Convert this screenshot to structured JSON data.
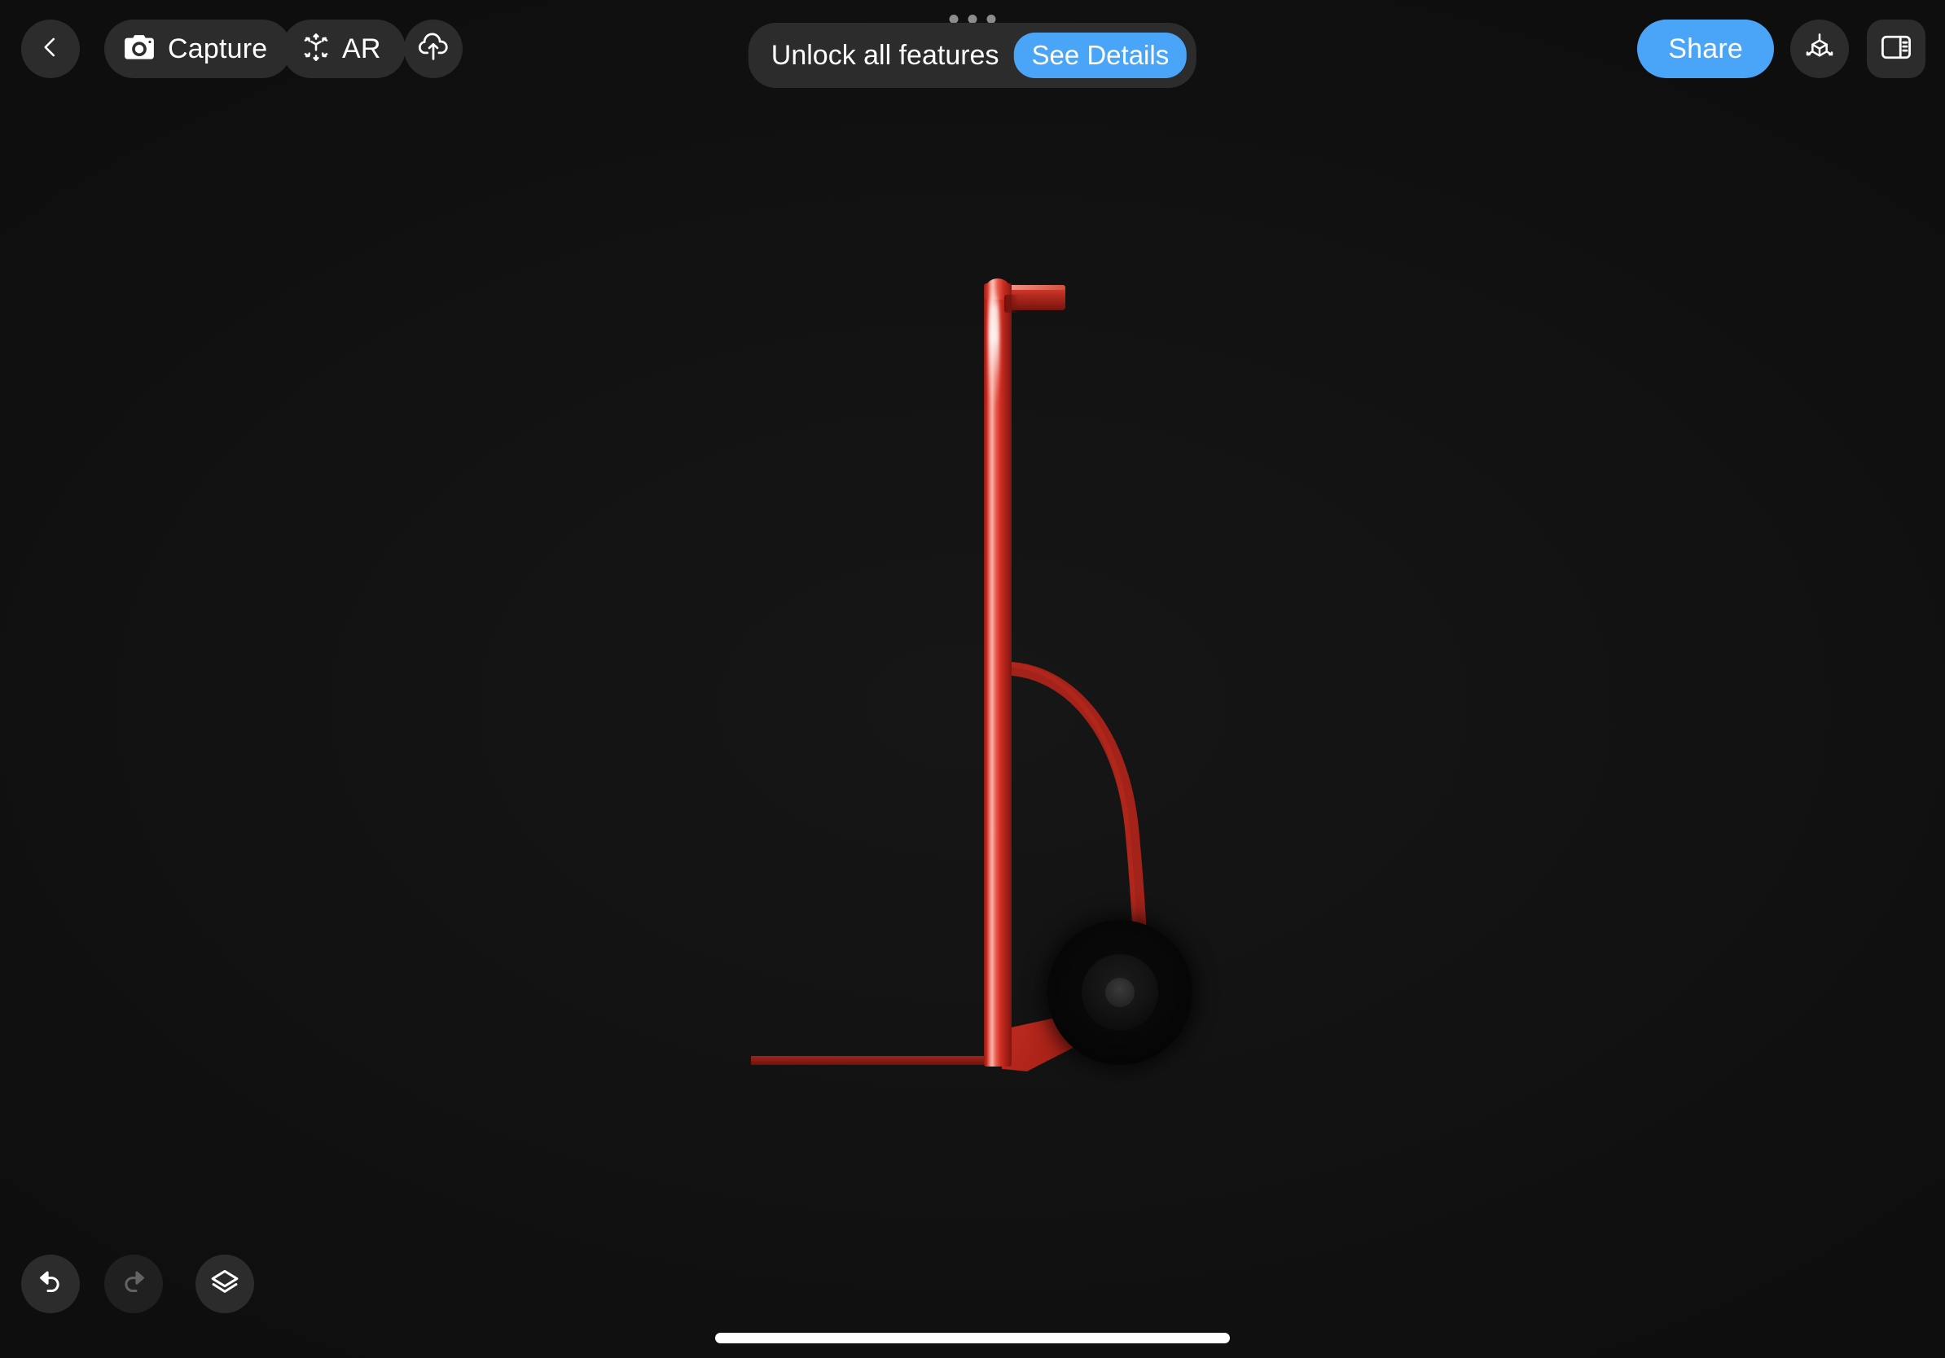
{
  "app": {
    "background_color": "#131313",
    "accent_color": "#4aa5f8",
    "pill_color": "#2c2c2c"
  },
  "toolbar": {
    "back_icon": "chevron-left-icon",
    "capture_label": "Capture",
    "capture_icon": "camera-icon",
    "ar_label": "AR",
    "ar_icon": "ar-cube-arrows-icon",
    "upload_icon": "cloud-upload-icon",
    "share_label": "Share",
    "cube_icon": "3d-cube-axis-icon",
    "panel_icon": "sidebar-panel-icon"
  },
  "promo": {
    "message": "Unlock all features",
    "cta_label": "See Details",
    "dots": [
      {
        "active": false
      },
      {
        "active": false
      },
      {
        "active": false
      }
    ]
  },
  "bottom": {
    "undo_icon": "undo-arrow-icon",
    "undo_enabled": "true",
    "redo_icon": "redo-arrow-icon",
    "redo_enabled": "false",
    "layers_icon": "layers-stack-icon",
    "home_indicator": "home-indicator-bar"
  },
  "viewport": {
    "model_name": "hand-truck-dolly-3d-model",
    "model_color": "#c8281d",
    "wheel_color": "#080808",
    "parts": [
      {
        "name": "vertical-post",
        "color": "#c8281d"
      },
      {
        "name": "handle-bar",
        "color": "#b32a1f"
      },
      {
        "name": "curved-brace",
        "color": "#a32219"
      },
      {
        "name": "foot-plate",
        "color": "#8a1c14"
      },
      {
        "name": "axle-bracket",
        "color": "#ad2419"
      },
      {
        "name": "wheel",
        "color": "#080808"
      }
    ]
  }
}
